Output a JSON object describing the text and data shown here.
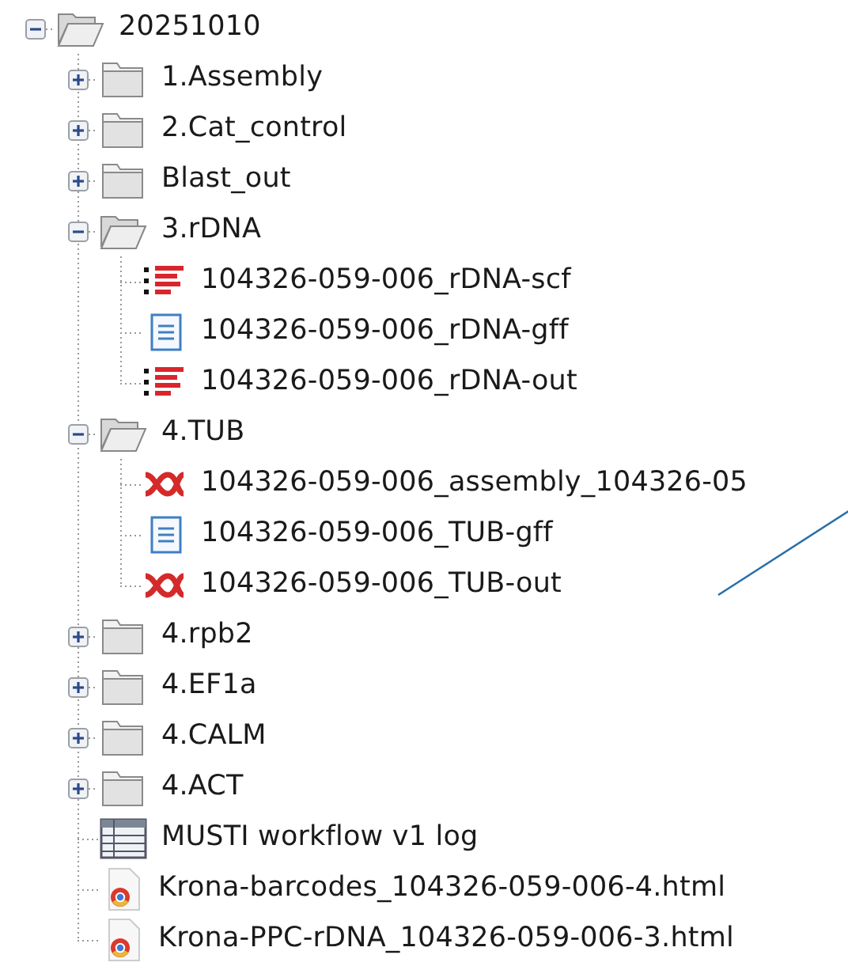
{
  "tree": {
    "label": "20251010",
    "kind": "folder",
    "expanded": true,
    "children": [
      {
        "label": "1.Assembly",
        "kind": "folder",
        "expanded": false
      },
      {
        "label": "2.Cat_control",
        "kind": "folder",
        "expanded": false
      },
      {
        "label": "Blast_out",
        "kind": "folder",
        "expanded": false
      },
      {
        "label": "3.rDNA",
        "kind": "folder",
        "expanded": true,
        "children": [
          {
            "label": "104326-059-006_rDNA-scf",
            "kind": "sequence"
          },
          {
            "label": "104326-059-006_rDNA-gff",
            "kind": "text"
          },
          {
            "label": "104326-059-006_rDNA-out",
            "kind": "sequence"
          }
        ]
      },
      {
        "label": "4.TUB",
        "kind": "folder",
        "expanded": true,
        "children": [
          {
            "label": "104326-059-006_assembly_104326-05",
            "kind": "alignment"
          },
          {
            "label": "104326-059-006_TUB-gff",
            "kind": "text"
          },
          {
            "label": "104326-059-006_TUB-out",
            "kind": "alignment"
          }
        ]
      },
      {
        "label": "4.rpb2",
        "kind": "folder",
        "expanded": false
      },
      {
        "label": "4.EF1a",
        "kind": "folder",
        "expanded": false
      },
      {
        "label": "4.CALM",
        "kind": "folder",
        "expanded": false
      },
      {
        "label": "4.ACT",
        "kind": "folder",
        "expanded": false
      },
      {
        "label": "MUSTI workflow v1 log",
        "kind": "table"
      },
      {
        "label": "Krona-barcodes_104326-059-006-4.html",
        "kind": "html"
      },
      {
        "label": "Krona-PPC-rDNA_104326-059-006-3.html",
        "kind": "html"
      }
    ]
  }
}
